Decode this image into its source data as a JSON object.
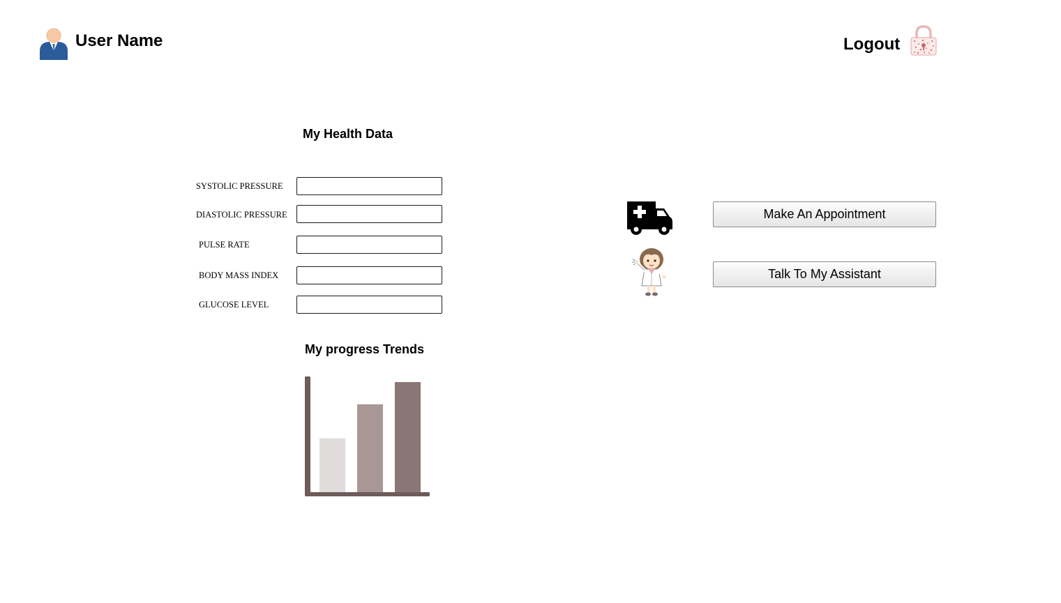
{
  "header": {
    "user_name": "User Name",
    "logout_label": "Logout",
    "avatar_icon": "user-avatar-icon",
    "logout_icon": "padlock-icon"
  },
  "health": {
    "title": "My Health Data",
    "fields": [
      {
        "label": "SYSTOLIC PRESSURE",
        "value": ""
      },
      {
        "label": "DIASTOLIC  PRESSURE",
        "value": ""
      },
      {
        "label": "PULSE RATE",
        "value": ""
      },
      {
        "label": "BODY MASS INDEX",
        "value": ""
      },
      {
        "label": "GLUCOSE LEVEL",
        "value": ""
      }
    ]
  },
  "trends": {
    "title": "My progress Trends"
  },
  "chart_data": {
    "type": "bar",
    "values": [
      46,
      75,
      94
    ],
    "ylim": [
      0,
      100
    ],
    "colors": [
      "#e0dcdb",
      "#a89795",
      "#8a7674"
    ],
    "axis_color": "#6e5c5a",
    "grid": false
  },
  "actions": {
    "appointment_label": "Make An Appointment",
    "assistant_label": "Talk To My Assistant",
    "appointment_icon": "ambulance-icon",
    "assistant_icon": "doctor-assistant-icon"
  }
}
